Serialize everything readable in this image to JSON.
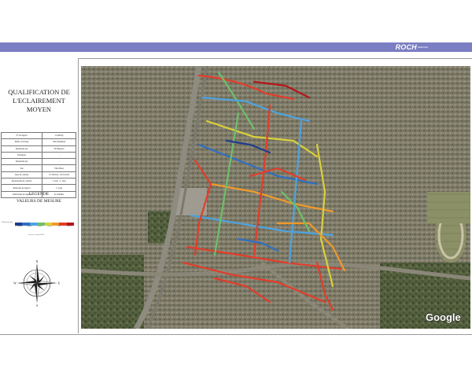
{
  "header": {
    "brand": "ROCH",
    "brand_sub": "SERVICE"
  },
  "title_line1": "QUALIFICATION DE",
  "title_line2": "L'ECLAIREMENT MOYEN",
  "info_rows": [
    {
      "label": "N° du rapport",
      "value": "14-4052Q"
    },
    {
      "label": "Maître d'ouvrage",
      "value": "Ville Epsinhem"
    },
    {
      "label": "Représenté par",
      "value": "M. Baguerre"
    },
    {
      "label": "Entreprise",
      "value": "-"
    },
    {
      "label": "Représenté par",
      "value": "-"
    },
    {
      "label": "Site",
      "value": "Ville Entier"
    },
    {
      "label": "Date du contrôle",
      "value": "27/10/2014 - 20/11/2014"
    },
    {
      "label": "Responsable du contrôle",
      "value": "a. Jean - C. Jauq"
    },
    {
      "label": "Rédacteur du rapport",
      "value": "C. Jauq"
    },
    {
      "label": "Vérificateur du rapport",
      "value": "R. Vanchier"
    }
  ],
  "legend": {
    "heading": "LEGENDE",
    "subheading": "VALEURS DE MESURE",
    "scale_label": "Éclairement (lux)",
    "scale_colors": [
      "#1f3d8a",
      "#2f6fc4",
      "#4ea3df",
      "#6cc06a",
      "#d9d13a",
      "#ef9a2b",
      "#e23d2a",
      "#b4161b"
    ],
    "scale_ticks": [
      "Insuffisant",
      "Insuffisant",
      "Acceptable",
      "Conforme",
      "Élevé",
      "Très élevé"
    ],
    "scale_note": "Valeurs en lux - normes EN13201"
  },
  "compass": {
    "n": "N",
    "s": "S",
    "e": "E",
    "w": "W"
  },
  "map": {
    "attribution": "Google"
  }
}
